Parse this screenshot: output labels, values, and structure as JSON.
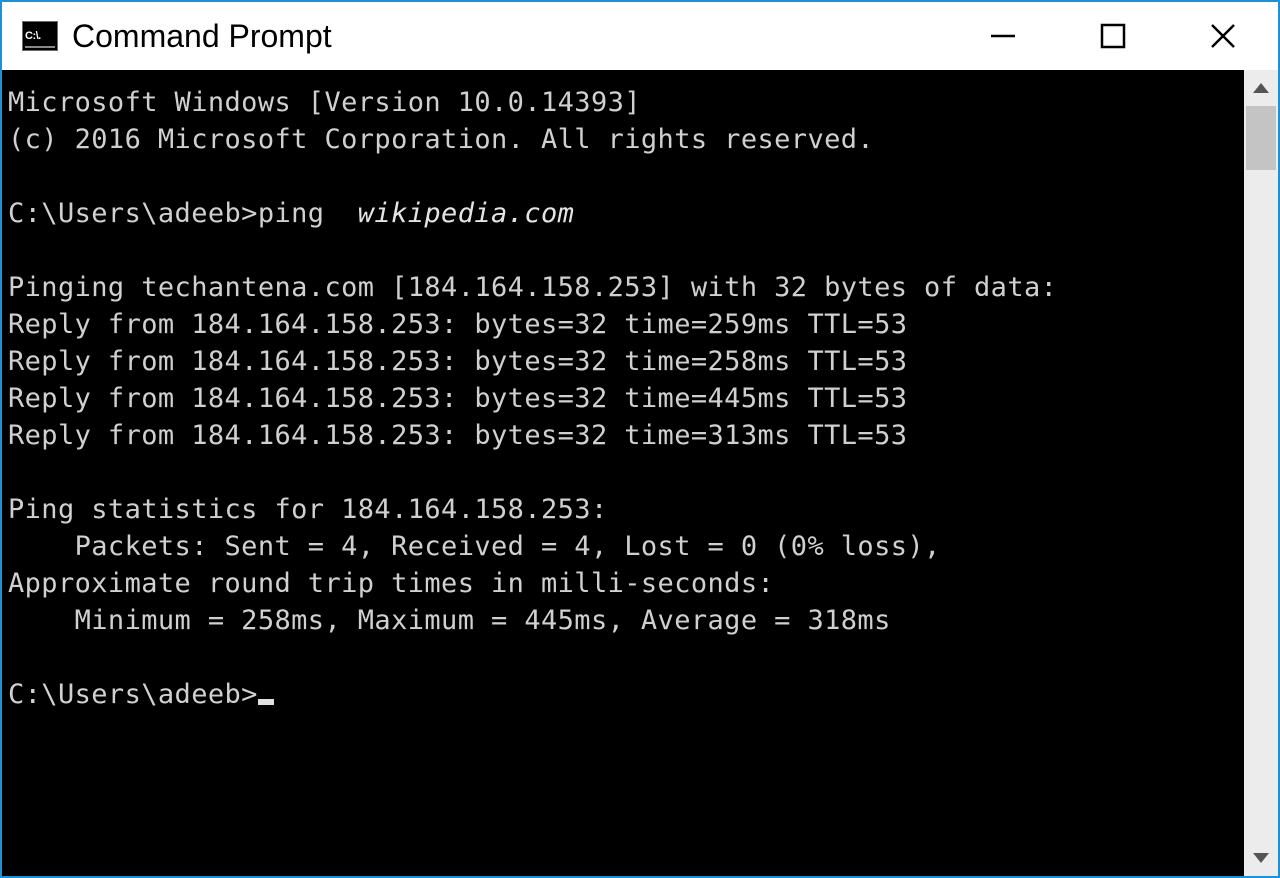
{
  "window": {
    "title": "Command Prompt",
    "icon_label": "C:\\."
  },
  "terminal": {
    "line_version": "Microsoft Windows [Version 10.0.14393]",
    "line_copyright": "(c) 2016 Microsoft Corporation. All rights reserved.",
    "prompt1_prefix": "C:\\Users\\adeeb>ping  ",
    "prompt1_cmd": "wikipedia.com",
    "ping_header": "Pinging techantena.com [184.164.158.253] with 32 bytes of data:",
    "reply1": "Reply from 184.164.158.253: bytes=32 time=259ms TTL=53",
    "reply2": "Reply from 184.164.158.253: bytes=32 time=258ms TTL=53",
    "reply3": "Reply from 184.164.158.253: bytes=32 time=445ms TTL=53",
    "reply4": "Reply from 184.164.158.253: bytes=32 time=313ms TTL=53",
    "stats_header": "Ping statistics for 184.164.158.253:",
    "stats_packets": "    Packets: Sent = 4, Received = 4, Lost = 0 (0% loss),",
    "stats_rtt_header": "Approximate round trip times in milli-seconds:",
    "stats_rtt": "    Minimum = 258ms, Maximum = 445ms, Average = 318ms",
    "prompt2": "C:\\Users\\adeeb>"
  }
}
